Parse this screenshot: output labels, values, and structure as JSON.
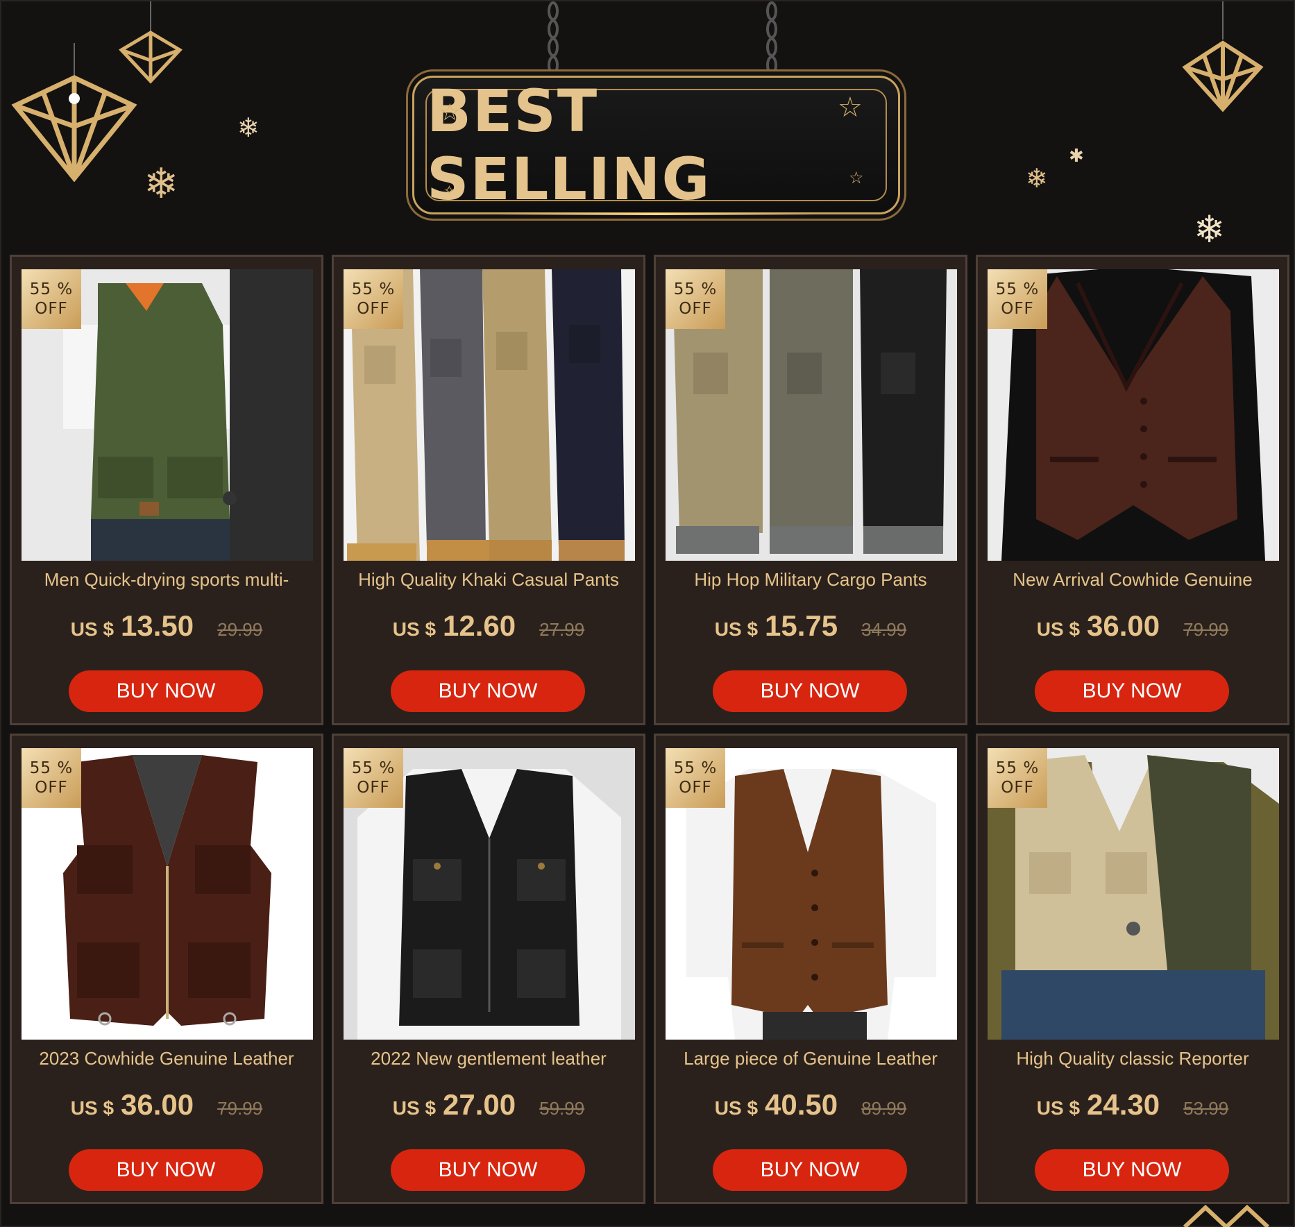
{
  "banner": {
    "title": "BEST SELLING"
  },
  "colors": {
    "background": "#141111",
    "card": "#2b211c",
    "gold": "#e5c38b",
    "button": "#d8250f"
  },
  "products": [
    {
      "badge_pct": "55 %",
      "badge_off": "OFF",
      "title": "Men Quick-drying sports multi-",
      "currency": "US $",
      "price": "13.50",
      "old_price": "29.99",
      "button": "BUY NOW",
      "image": "green-vest-photo"
    },
    {
      "badge_pct": "55 %",
      "badge_off": "OFF",
      "title": "High Quality Khaki Casual Pants",
      "currency": "US $",
      "price": "12.60",
      "old_price": "27.99",
      "button": "BUY NOW",
      "image": "khaki-cargo-pants-photo"
    },
    {
      "badge_pct": "55 %",
      "badge_off": "OFF",
      "title": "Hip Hop Military Cargo Pants",
      "currency": "US $",
      "price": "15.75",
      "old_price": "34.99",
      "button": "BUY NOW",
      "image": "military-cargo-pants-photo"
    },
    {
      "badge_pct": "55 %",
      "badge_off": "OFF",
      "title": "New Arrival Cowhide Genuine",
      "currency": "US $",
      "price": "36.00",
      "old_price": "79.99",
      "button": "BUY NOW",
      "image": "brown-leather-vest-photo"
    },
    {
      "badge_pct": "55 %",
      "badge_off": "OFF",
      "title": "2023 Cowhide Genuine Leather",
      "currency": "US $",
      "price": "36.00",
      "old_price": "79.99",
      "button": "BUY NOW",
      "image": "leather-utility-vest-photo"
    },
    {
      "badge_pct": "55 %",
      "badge_off": "OFF",
      "title": "2022 New gentlement leather",
      "currency": "US $",
      "price": "27.00",
      "old_price": "59.99",
      "button": "BUY NOW",
      "image": "black-leather-vest-photo"
    },
    {
      "badge_pct": "55 %",
      "badge_off": "OFF",
      "title": "Large piece of Genuine Leather",
      "currency": "US $",
      "price": "40.50",
      "old_price": "89.99",
      "button": "BUY NOW",
      "image": "tan-leather-vest-photo"
    },
    {
      "badge_pct": "55 %",
      "badge_off": "OFF",
      "title": "High Quality classic Reporter",
      "currency": "US $",
      "price": "24.30",
      "old_price": "53.99",
      "button": "BUY NOW",
      "image": "reporter-vest-photo"
    }
  ]
}
